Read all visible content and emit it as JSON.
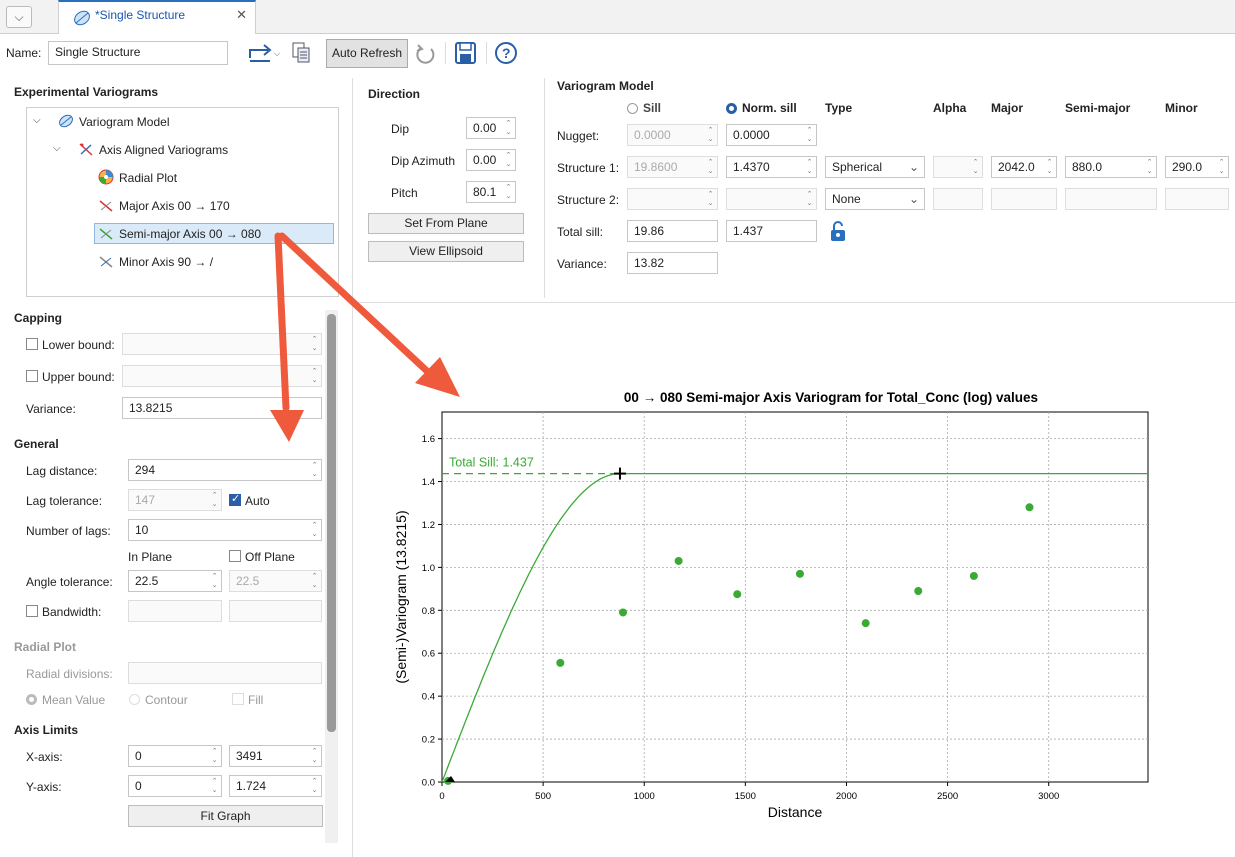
{
  "tab": {
    "title": "*Single Structure",
    "close": "✕"
  },
  "toolbar": {
    "name_label": "Name:",
    "name_value": "Single Structure",
    "auto_refresh": "Auto Refresh"
  },
  "exp": {
    "title": "Experimental Variograms",
    "tree": {
      "root": "Variogram Model",
      "group": "Axis Aligned Variograms",
      "items": [
        "Radial Plot",
        "Major Axis 00 → 170",
        "Semi-major Axis 00 → 080",
        "Minor Axis 90 → /"
      ]
    }
  },
  "direction": {
    "title": "Direction",
    "dip_label": "Dip",
    "dip_value": "0.00",
    "azimuth_label": "Dip Azimuth",
    "azimuth_value": "0.00",
    "pitch_label": "Pitch",
    "pitch_value": "80.1",
    "set_from_plane": "Set From Plane",
    "view_ellipsoid": "View Ellipsoid"
  },
  "model": {
    "title": "Variogram Model",
    "sill_label": "Sill",
    "norm_sill_label": "Norm. sill",
    "headers": {
      "type": "Type",
      "alpha": "Alpha",
      "major": "Major",
      "semi": "Semi-major",
      "minor": "Minor"
    },
    "nugget": {
      "label": "Nugget:",
      "sill": "0.0000",
      "norm": "0.0000"
    },
    "s1": {
      "label": "Structure 1:",
      "sill": "19.8600",
      "norm": "1.4370",
      "type": "Spherical",
      "alpha": "",
      "major": "2042.0",
      "semi": "880.0",
      "minor": "290.0"
    },
    "s2": {
      "label": "Structure 2:",
      "sill": "",
      "norm": "",
      "type": "None"
    },
    "total": {
      "label": "Total sill:",
      "sill": "19.86",
      "norm": "1.437"
    },
    "variance": {
      "label": "Variance:",
      "value": "13.82"
    }
  },
  "capping": {
    "title": "Capping",
    "lower_label": "Lower bound:",
    "upper_label": "Upper bound:",
    "variance_label": "Variance:",
    "variance_value": "13.8215"
  },
  "general": {
    "title": "General",
    "lag_distance_label": "Lag distance:",
    "lag_distance": "294",
    "lag_tolerance_label": "Lag tolerance:",
    "lag_tolerance": "147",
    "auto_label": "Auto",
    "num_lags_label": "Number of lags:",
    "num_lags": "10",
    "in_plane": "In Plane",
    "off_plane": "Off Plane",
    "angle_tol_label": "Angle tolerance:",
    "angle_tol_in": "22.5",
    "angle_tol_off": "22.5",
    "bandwidth_label": "Bandwidth:"
  },
  "radial": {
    "title": "Radial Plot",
    "divisions_label": "Radial divisions:",
    "mean": "Mean Value",
    "contour": "Contour",
    "fill": "Fill"
  },
  "axis_limits": {
    "title": "Axis Limits",
    "x_label": "X-axis:",
    "x_min": "0",
    "x_max": "3491",
    "y_label": "Y-axis:",
    "y_min": "0",
    "y_max": "1.724",
    "fit_graph": "Fit Graph"
  },
  "chart_data": {
    "type": "scatter",
    "title": "00 → 080 Semi-major Axis Variogram for Total_Conc (log) values",
    "xlabel": "Distance",
    "ylabel": "(Semi-)Variogram (13.8215)",
    "xlim": [
      0,
      3491
    ],
    "ylim": [
      0,
      1.724
    ],
    "xticks": [
      0,
      500,
      1000,
      1500,
      2000,
      2500,
      3000
    ],
    "yticks": [
      0.0,
      0.2,
      0.4,
      0.6,
      0.8,
      1.0,
      1.2,
      1.4,
      1.6
    ],
    "grid": true,
    "sill_label": "Total Sill: 1.437",
    "sill": 1.437,
    "range": 880,
    "points": [
      {
        "x": 30,
        "y": 0.005
      },
      {
        "x": 585,
        "y": 0.555
      },
      {
        "x": 895,
        "y": 0.79
      },
      {
        "x": 1170,
        "y": 1.03
      },
      {
        "x": 1460,
        "y": 0.875
      },
      {
        "x": 1770,
        "y": 0.97
      },
      {
        "x": 2095,
        "y": 0.74
      },
      {
        "x": 2355,
        "y": 0.89
      },
      {
        "x": 2630,
        "y": 0.96
      },
      {
        "x": 2905,
        "y": 1.28
      }
    ],
    "point_color": "#3aaa35",
    "model_color": "#3aaa35"
  }
}
